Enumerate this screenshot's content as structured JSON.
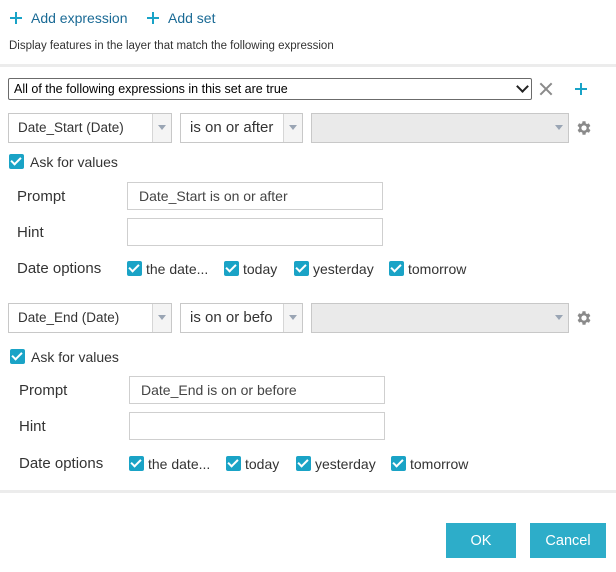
{
  "toolbar": {
    "add_expression_label": "Add expression",
    "add_set_label": "Add set"
  },
  "description": "Display features in the layer that match the following expression",
  "set": {
    "condition": "All of the following expressions in this set are true"
  },
  "expressions": [
    {
      "field": "Date_Start (Date)",
      "operator": "is on or after",
      "value": "",
      "ask_label": "Ask for values",
      "prompt_label": "Prompt",
      "prompt_value": "Date_Start is on or after",
      "hint_label": "Hint",
      "hint_value": "",
      "date_options_label": "Date options",
      "date_options": [
        "the date...",
        "today",
        "yesterday",
        "tomorrow"
      ]
    },
    {
      "field": "Date_End (Date)",
      "operator": "is on or befo",
      "value": "",
      "ask_label": "Ask for values",
      "prompt_label": "Prompt",
      "prompt_value": "Date_End is on or before",
      "hint_label": "Hint",
      "hint_value": "",
      "date_options_label": "Date options",
      "date_options": [
        "the date...",
        "today",
        "yesterday",
        "tomorrow"
      ]
    }
  ],
  "footer": {
    "ok_label": "OK",
    "cancel_label": "Cancel"
  },
  "colors": {
    "accent": "#2dadc9",
    "link": "#1a6a95"
  }
}
